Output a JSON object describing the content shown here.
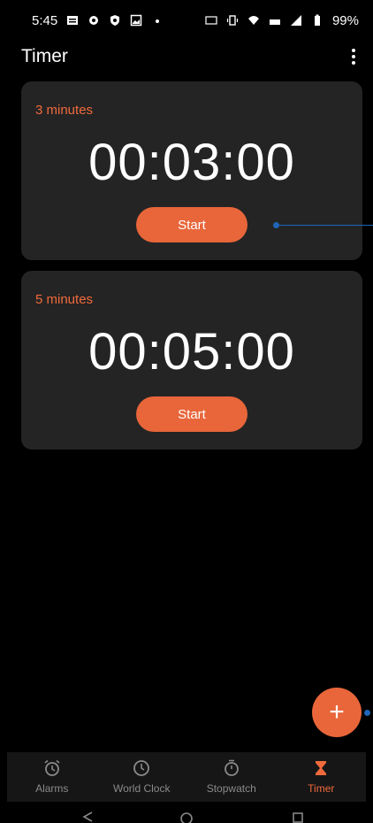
{
  "status": {
    "time": "5:45",
    "battery": "99%"
  },
  "appbar": {
    "title": "Timer"
  },
  "timers": [
    {
      "label": "3 minutes",
      "time": "00:03:00",
      "start_label": "Start"
    },
    {
      "label": "5 minutes",
      "time": "00:05:00",
      "start_label": "Start"
    }
  ],
  "fab": {
    "label": "+"
  },
  "bottom_nav": {
    "items": [
      {
        "label": "Alarms",
        "icon": "alarm-icon"
      },
      {
        "label": "World Clock",
        "icon": "clock-icon"
      },
      {
        "label": "Stopwatch",
        "icon": "stopwatch-icon"
      },
      {
        "label": "Timer",
        "icon": "hourglass-icon",
        "active": true
      }
    ]
  },
  "colors": {
    "accent": "#e8663a",
    "card": "#242424",
    "annotation": "#1e66b8"
  }
}
